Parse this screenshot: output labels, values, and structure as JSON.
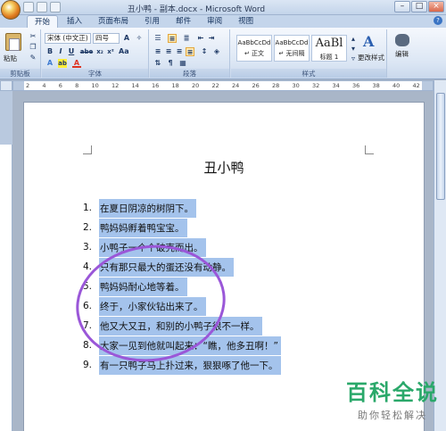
{
  "window": {
    "title": "丑小鸭 - 副本.docx - Microsoft Word",
    "minimize": "–",
    "maximize": "□",
    "close": "×"
  },
  "tabs": [
    "开始",
    "插入",
    "页面布局",
    "引用",
    "邮件",
    "审阅",
    "视图"
  ],
  "ribbon": {
    "clipboard": {
      "paste_label": "粘贴",
      "group_label": "剪贴板"
    },
    "font": {
      "font_name": "宋体 (中文正)",
      "font_size": "四号",
      "group_label": "字体",
      "bold": "B",
      "italic": "I",
      "underline": "U",
      "strike": "abe",
      "subscript": "x₂",
      "superscript": "x²",
      "grow": "A",
      "highlight": "ab",
      "color": "A"
    },
    "paragraph": {
      "group_label": "段落"
    },
    "styles": {
      "group_label": "样式",
      "items": [
        {
          "sample": "AaBbCcDd",
          "name": "↵ 正文"
        },
        {
          "sample": "AaBbCcDd",
          "name": "↵ 无间隔"
        },
        {
          "sample": "AaBl",
          "name": "标题 1"
        }
      ],
      "change_styles": "更改样式"
    },
    "editing": {
      "label": "编辑"
    }
  },
  "ruler": {
    "ticks": [
      "2",
      "4",
      "6",
      "8",
      "10",
      "12",
      "14",
      "16",
      "18",
      "20",
      "22",
      "24",
      "26",
      "28",
      "30",
      "32",
      "34",
      "36",
      "38",
      "40",
      "42"
    ]
  },
  "document": {
    "title": "丑小鸭",
    "items": [
      {
        "num": "1.",
        "text": "在夏日阴凉的树阴下。"
      },
      {
        "num": "2.",
        "text": "鸭妈妈孵着鸭宝宝。"
      },
      {
        "num": "3.",
        "text": "小鸭子一个个破壳而出。"
      },
      {
        "num": "4.",
        "text": "只有那只最大的蛋还没有动静。"
      },
      {
        "num": "5.",
        "text": "鸭妈妈耐心地等着。"
      },
      {
        "num": "6.",
        "text": "终于，小家伙钻出来了。"
      },
      {
        "num": "7.",
        "text": "他又大又丑，和别的小鸭子很不一样。"
      },
      {
        "num": "8.",
        "text": "大家一见到他就叫起来：“瞧，他多丑啊！”"
      },
      {
        "num": "9.",
        "text": "有一只鸭子马上扑过来，狠狠啄了他一下。"
      }
    ]
  },
  "watermark": {
    "title": "百科全说",
    "subtitle": "助你轻松解决"
  },
  "colors": {
    "selection": "#a4c3ec",
    "annotation_circle": "#9a57d8",
    "watermark": "#2aa86a"
  }
}
